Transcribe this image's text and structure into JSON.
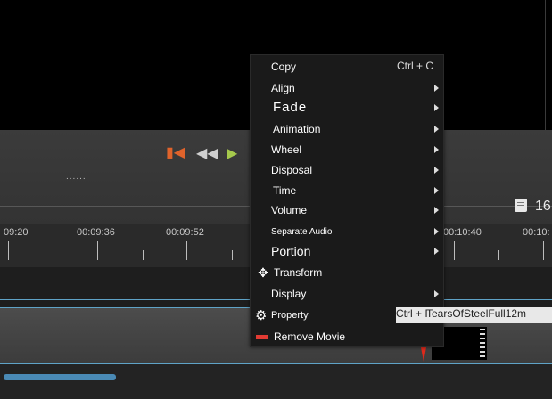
{
  "toolbar": {
    "dots": "......",
    "zoom_value": "16"
  },
  "ruler": {
    "labels": [
      "09:20",
      "00:09:36",
      "00:09:52",
      "00:10:40",
      "00:10:"
    ]
  },
  "context_menu": {
    "items": [
      {
        "label": "Copy",
        "shortcut": "Ctrl + C"
      },
      {
        "label": "Align"
      },
      {
        "label": "Fade"
      },
      {
        "label": "Animation"
      },
      {
        "label": "Wheel"
      },
      {
        "label": "Disposal"
      },
      {
        "label": "Time"
      },
      {
        "label": "Volume"
      },
      {
        "label": "Separate Audio"
      },
      {
        "label": "Portion"
      },
      {
        "label": "Transform"
      },
      {
        "label": "Display"
      },
      {
        "label": "Property",
        "shortcut": "Ctrl + I"
      },
      {
        "label": "Remove Movie"
      }
    ]
  },
  "clip": {
    "name": "TearsOfSteelFull12m"
  },
  "colors": {
    "accent_blue": "#4a8ab5",
    "playhead_red": "#e12a1c",
    "remove_red": "#e23b33",
    "play_green": "#a5c94c",
    "start_orange": "#e0632b"
  }
}
